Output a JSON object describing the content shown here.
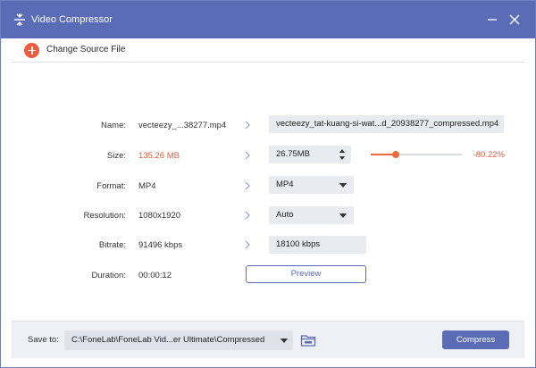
{
  "window": {
    "title": "Video Compressor",
    "icons": {
      "app": "compress-icon",
      "minimize": "minimize-icon",
      "close": "close-icon"
    }
  },
  "toolbar": {
    "change_source_label": "Change Source File",
    "icon": "plus-circle-icon"
  },
  "fields": {
    "name": {
      "label": "Name:",
      "source": "vecteezy_...38277.mp4",
      "output": "vecteezy_tat-kuang-si-wat...d_20938277_compressed.mp4"
    },
    "size": {
      "label": "Size:",
      "source": "135.26 MB",
      "output": "26.75MB",
      "ratio_fraction": 0.27,
      "percent": "-80.22%"
    },
    "format": {
      "label": "Format:",
      "source": "MP4",
      "output": "MP4"
    },
    "resolution": {
      "label": "Resolution:",
      "source": "1080x1920",
      "output": "Auto"
    },
    "bitrate": {
      "label": "Bitrate:",
      "source": "91496 kbps",
      "output": "18100 kbps"
    },
    "duration": {
      "label": "Duration:",
      "source": "00:00:12"
    }
  },
  "preview_label": "Preview",
  "footer": {
    "save_label": "Save to:",
    "path": "C:\\FoneLab\\FoneLab Vid...er Ultimate\\Compressed",
    "compress_label": "Compress",
    "folder_icon": "folder-icon"
  },
  "colors": {
    "title_bar": "#5b6cb6",
    "accent": "#5b6cb6",
    "warning": "#ef5a3a",
    "slider": "#f06a3c",
    "field_bg": "#e8ebf0"
  }
}
